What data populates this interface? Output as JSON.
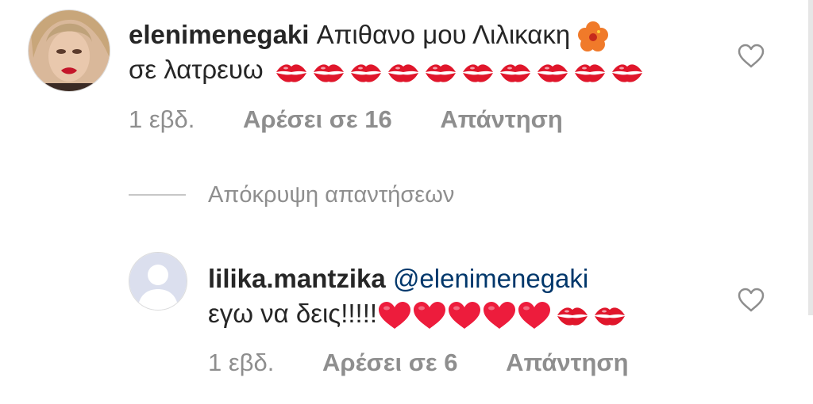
{
  "comments": [
    {
      "username": "elenimenegaki",
      "text_line1": "Απιθανο μου Λιλικακη",
      "text_line2": "σε λατρευω",
      "time": "1 εβδ.",
      "likes": "Αρέσει σε 16",
      "reply": "Απάντηση",
      "emoji_flower": "hibiscus-emoji",
      "kiss_count": 10
    },
    {
      "username": "lilika.mantzika",
      "mention": "@elenimenegaki",
      "text_line2": "εγω να δεις!!!!!",
      "time": "1 εβδ.",
      "likes": "Αρέσει σε 6",
      "reply": "Απάντηση",
      "heart_count": 5,
      "kiss_count": 2
    }
  ],
  "hide_replies": "Απόκρυψη απαντήσεων",
  "colors": {
    "mention": "#00376b",
    "meta": "#8e8e8e",
    "kiss": "#e0162b",
    "heart": "#ed1c3c"
  }
}
